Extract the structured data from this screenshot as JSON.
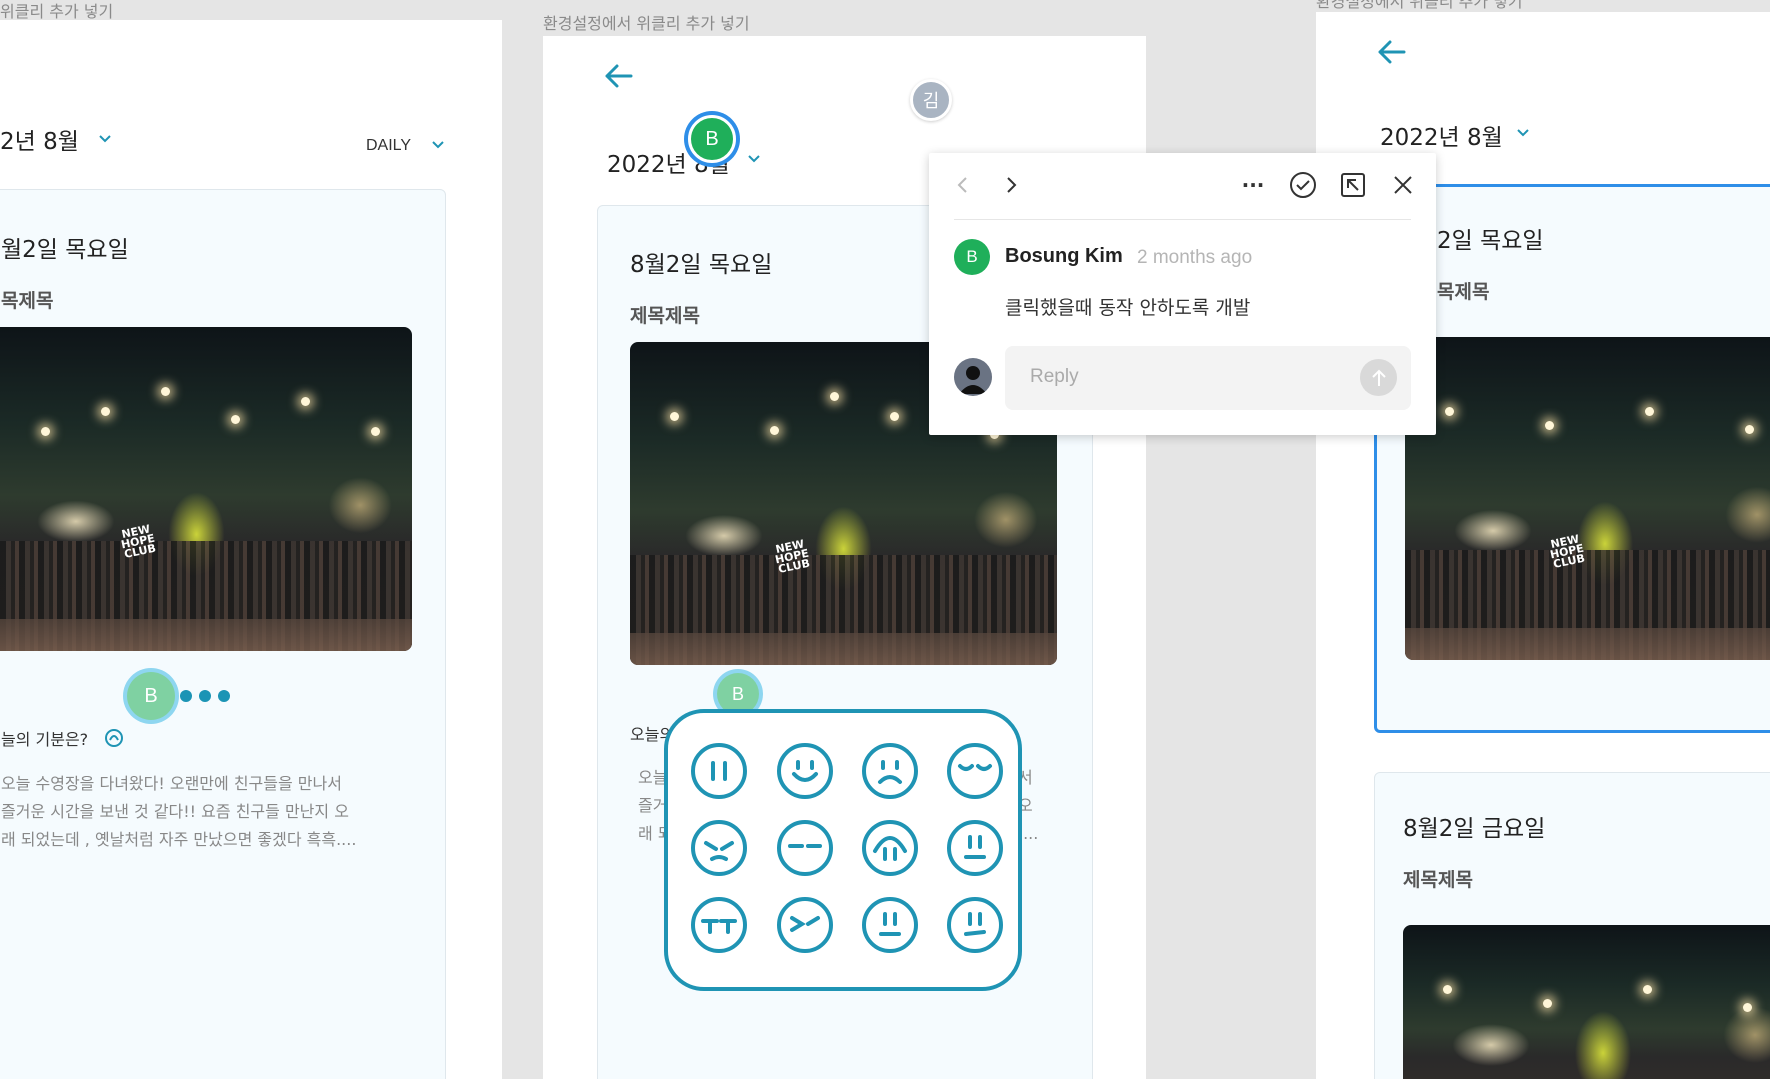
{
  "frames": {
    "left": {
      "label": "위클리 추가 넣기",
      "month": "2년 8월",
      "view_select": "DAILY",
      "card": {
        "date": "월2일 목요일",
        "subtitle": "목제목",
        "mood_question": "늘의 기분은?",
        "body_lines": [
          "오늘 수영장을 다녀왔다! 오랜만에 친구들을 만나서",
          "즐거운 시간을 보낸 것 같다!! 요즘 친구들 만난지 오",
          "래 되었는데 , 옛날처럼 자주 만났으면 좋겠다 흑흑...."
        ]
      }
    },
    "middle": {
      "label": "환경설정에서 위클리 추가 넣기",
      "month": "2022년 8월",
      "card": {
        "date": "8월2일 목요일",
        "subtitle": "제목제목",
        "mood_question": "오늘의",
        "body_fragments": [
          "오늘",
          "즐거",
          "래 되",
          "서",
          "오",
          "...."
        ]
      }
    },
    "right": {
      "label": "환경설정에서 위클리 추가 넣기",
      "month": "2022년 8월",
      "card1": {
        "date": "2일 목요일",
        "subtitle": "목제목"
      },
      "card2": {
        "date": "8월2일 금요일",
        "subtitle": "제목제목"
      }
    }
  },
  "photo_text": [
    "NEW",
    "HOPE",
    "CLUB"
  ],
  "presence": {
    "kim_initial": "김",
    "b_initial": "B"
  },
  "comment": {
    "author_initial": "B",
    "author": "Bosung Kim",
    "time": "2 months ago",
    "text": "클릭했을때 동작 안하도록 개발",
    "reply_placeholder": "Reply",
    "toolbar_more": "···"
  },
  "emoji_faces": [
    [
      "pause-face-icon",
      "smile-face-icon",
      "sad-face-icon",
      "sleepy-face-icon"
    ],
    [
      "squint-face-icon",
      "dash-eyes-face-icon",
      "arc-face-icon",
      "neutral-face-icon"
    ],
    [
      "crying-face-icon",
      "grumpy-face-icon",
      "flat-face-icon",
      "meh-face-icon"
    ]
  ],
  "colors": {
    "accent": "#1f94b4",
    "avatar_green": "#1faf5a",
    "kim_gray": "#a9b4c2",
    "selection_blue": "#2e8ee8"
  }
}
